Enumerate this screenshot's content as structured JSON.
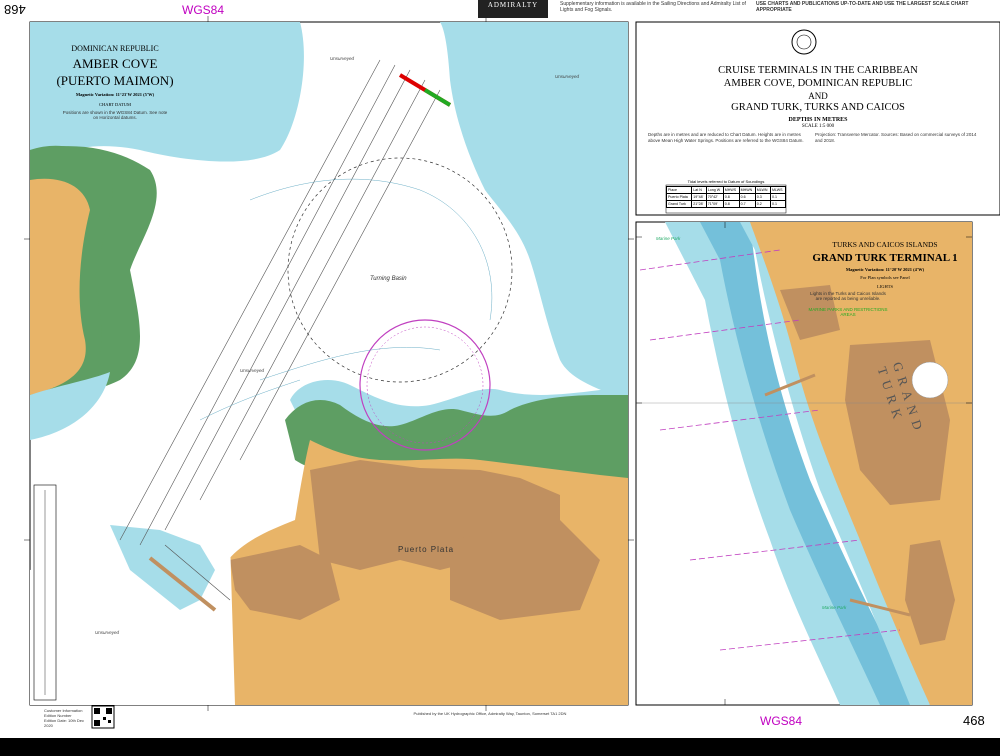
{
  "header": {
    "page_number_left": "468",
    "wgs_left": "WGS84",
    "logo": "ADMIRALTY",
    "notes_left": "Supplementary information is available in the Sailing Directions and Admiralty List of Lights and Fog Signals.",
    "notes_right": "USE CHARTS AND PUBLICATIONS UP-TO-DATE AND USE THE LARGEST SCALE CHART APPROPRIATE"
  },
  "amber_cove": {
    "region": "DOMINICAN REPUBLIC",
    "title_line1": "AMBER COVE",
    "title_line2": "(PUERTO MAIMON)",
    "magnetic": "Magnetic Variation: 11°23'W 2021 (5'W)",
    "datum_heading": "CHART DATUM",
    "datum_text": "Positions are shown in the WGS84 Datum. See note on Horizontal datums.",
    "labels": {
      "turning_basin": "Turning Basin",
      "puerto_plata": "Puerto Plata",
      "unsurveyed_1": "Unsurveyed",
      "unsurveyed_2": "Unsurveyed",
      "unsurveyed_3": "Unsurveyed",
      "unsurveyed_4": "Unsurveyed"
    }
  },
  "main_title": {
    "line1": "CRUISE TERMINALS IN THE CARIBBEAN",
    "line2": "AMBER COVE, DOMINICAN REPUBLIC",
    "line3": "AND",
    "line4": "GRAND TURK, TURKS AND CAICOS",
    "depths": "DEPTHS IN METRES",
    "scale": "SCALE 1:5 000",
    "notes": "Depths are in metres and are reduced to Chart Datum. Heights are in metres above Mean High Water Springs. Positions are referred to the WGS84 Datum.",
    "projection": "Projection: Transverse Mercator. Sources: Based on commercial surveys of 2014 and 2018."
  },
  "tide_table": {
    "caption": "Tidal levels referred to Datum of Soundings",
    "headers": [
      "Place",
      "Lat N",
      "Long W",
      "MHWS",
      "MHWN",
      "MLWN",
      "MLWS"
    ],
    "rows": [
      [
        "Puerto Plata",
        "19°48'",
        "70°42'",
        "0.8",
        "0.6",
        "0.3",
        "0.1"
      ],
      [
        "Grand Turk",
        "21°28'",
        "71°09'",
        "0.8",
        "0.7",
        "0.2",
        "0.1"
      ]
    ]
  },
  "grand_turk": {
    "region": "TURKS AND CAICOS ISLANDS",
    "title": "GRAND TURK TERMINAL 1",
    "magnetic": "Magnetic Variation: 11°20'W 2021 (4'W)",
    "sub": "For Plan symbols see Panel",
    "lights_heading": "LIGHTS",
    "lights_text": "Lights in the Turks and Caicos Islands are reported as being unreliable.",
    "caution": "MARINE PARKS AND RESTRICTIONS AREAS",
    "labels": {
      "island": "GRAND TURK",
      "marine_park_1": "Marine Park",
      "marine_park_2": "Marine Park"
    }
  },
  "footer": {
    "customer_info": "Customer Information",
    "edition_number": "Edition Number",
    "edition_date": "Edition Date: 10th Dec 2020",
    "publisher": "Published by the UK Hydrographic Office, Admiralty Way, Taunton, Somerset TA1 2DN",
    "page_number_right": "468",
    "wgs_right": "WGS84"
  },
  "colors": {
    "land": "#e8b468",
    "land_dark": "#c09060",
    "drying": "#5e9e63",
    "shallow": "#a6dde9",
    "deep_blue": "#74c0da",
    "deep": "#ffffff",
    "magenta": "#c040c0"
  }
}
